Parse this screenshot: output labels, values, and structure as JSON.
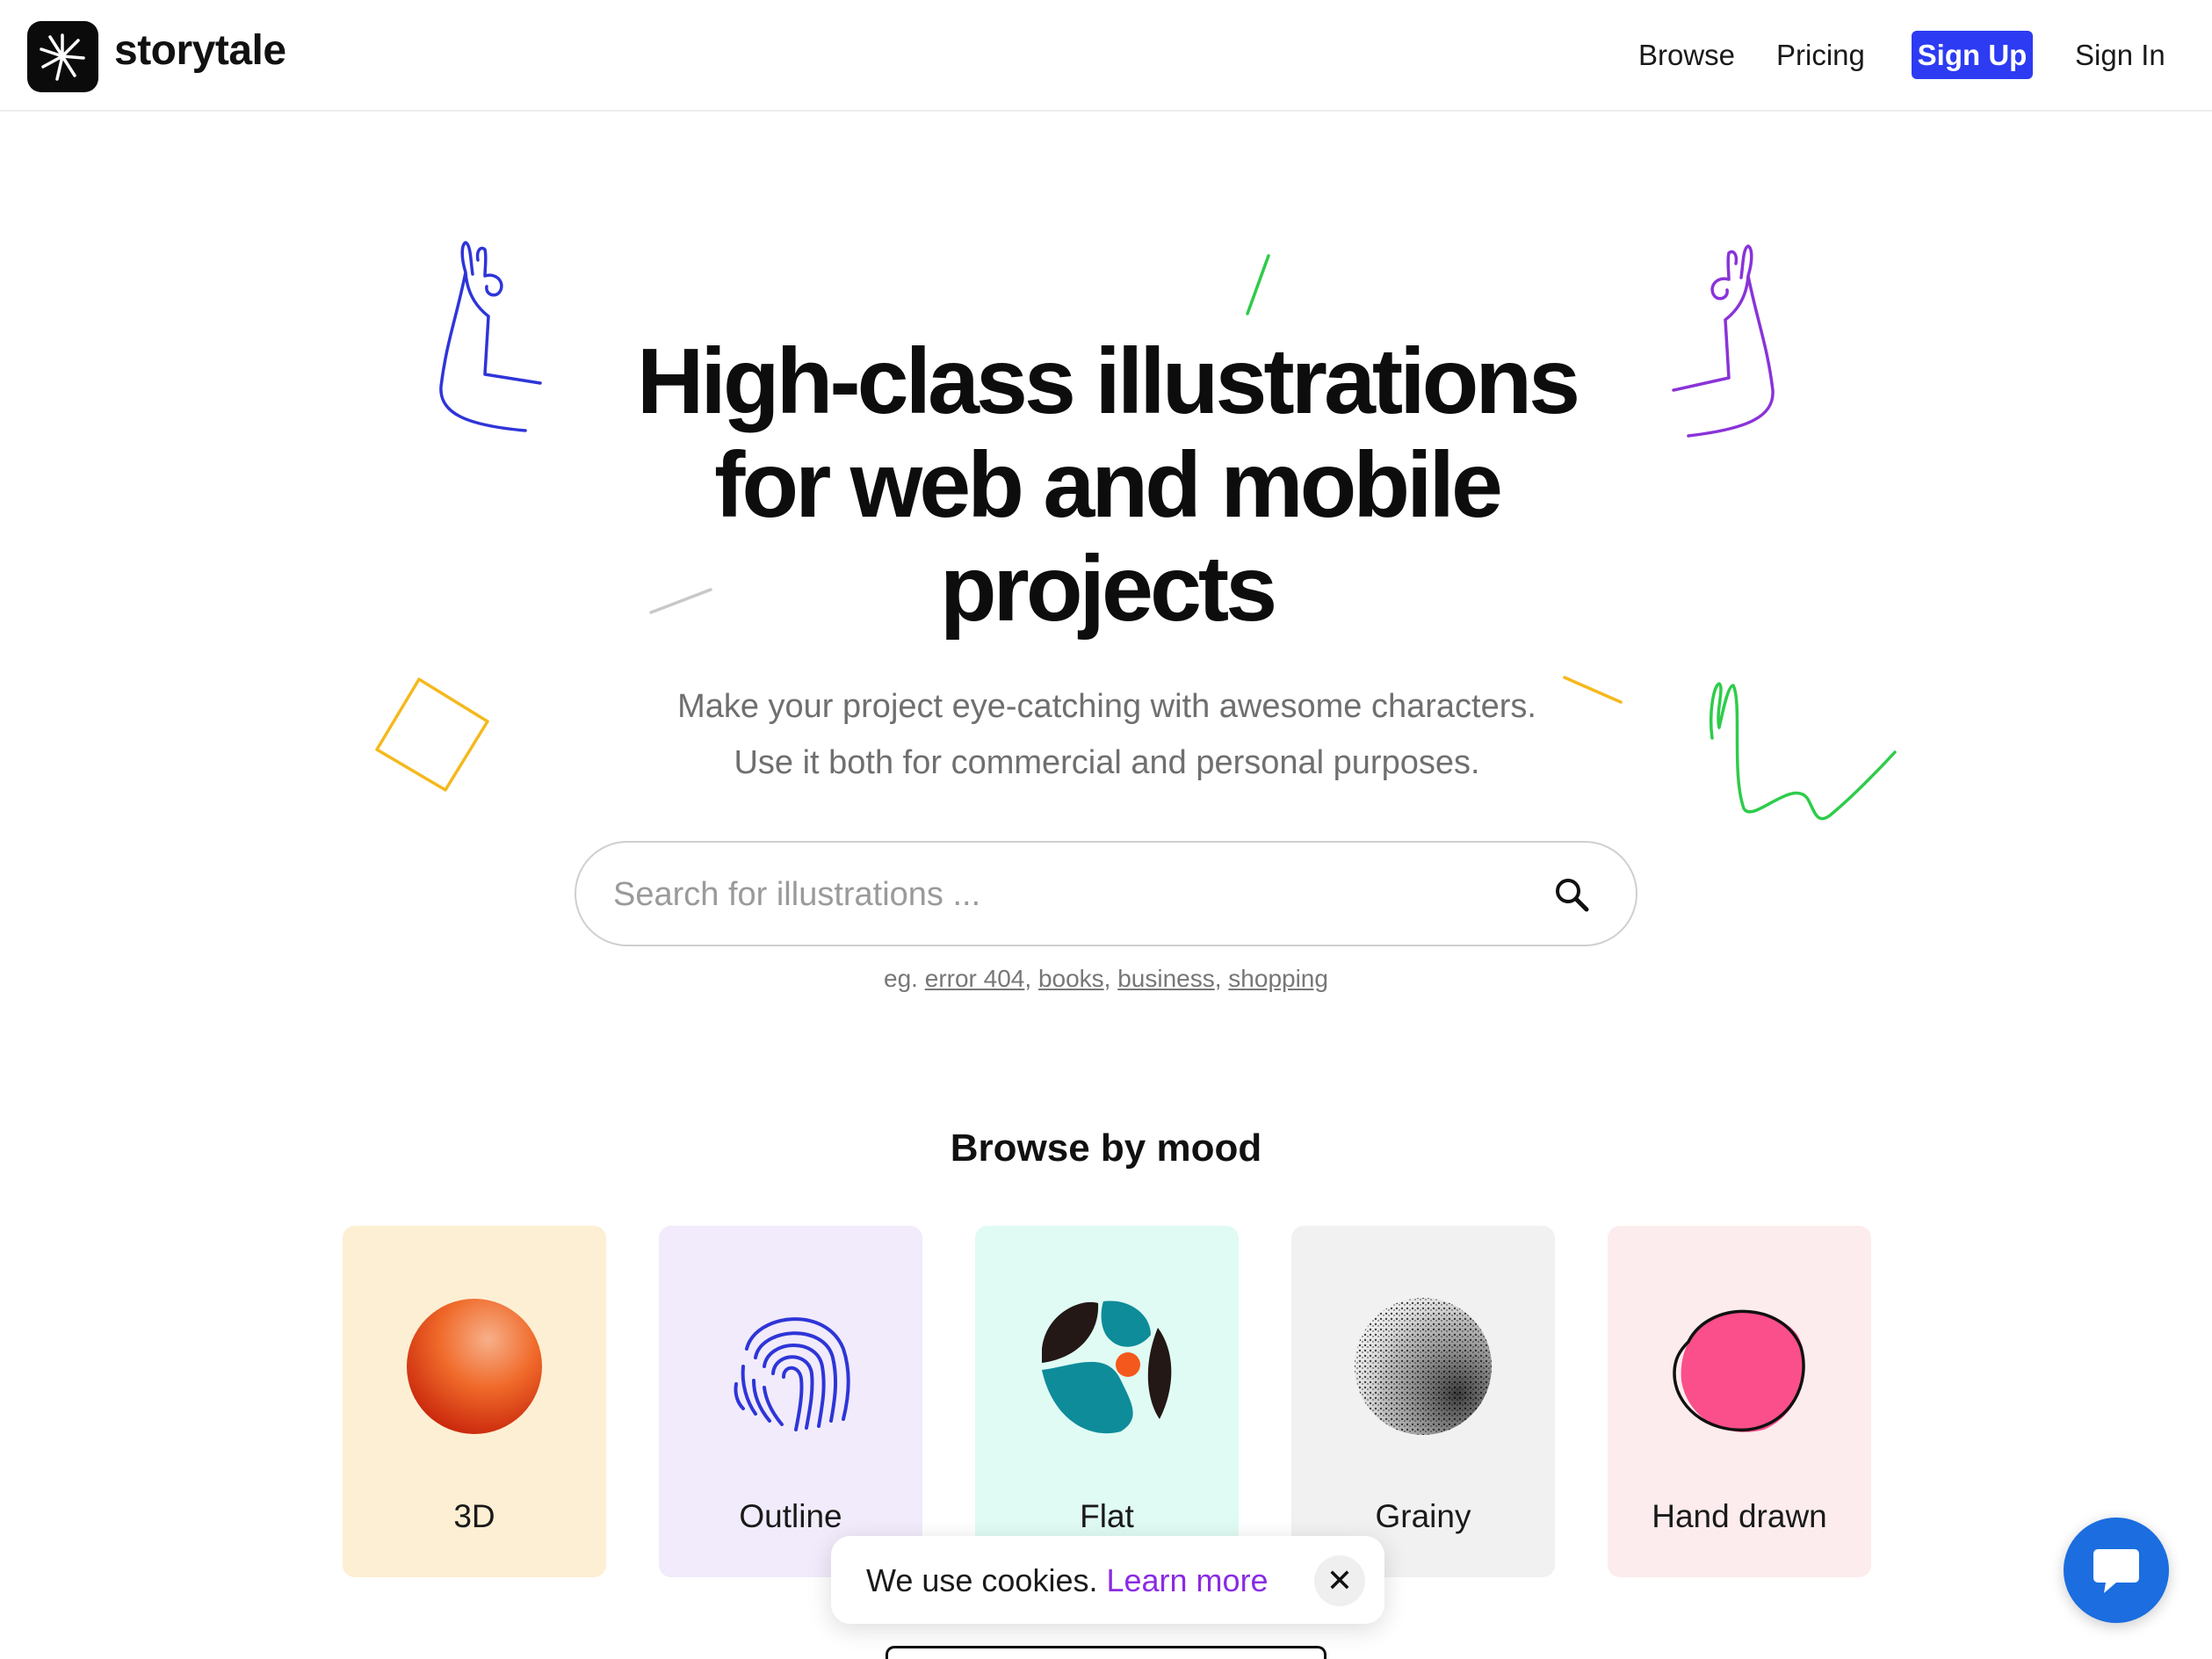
{
  "header": {
    "brand": "storytale",
    "nav": {
      "browse": "Browse",
      "pricing": "Pricing",
      "sign_up": "Sign Up",
      "sign_in": "Sign In"
    },
    "accent_color": "#2d3bf2"
  },
  "hero": {
    "title_line1": "High-class illustrations",
    "title_line2": "for web and mobile",
    "title_line3": "projects",
    "subtitle_line1": "Make your project eye-catching with awesome characters.",
    "subtitle_line2": "Use it both for commercial and personal purposes."
  },
  "search": {
    "placeholder": "Search for illustrations ...",
    "value": "",
    "examples_prefix": "eg.",
    "examples": [
      "error 404",
      "books",
      "business",
      "shopping"
    ]
  },
  "mood": {
    "title": "Browse by mood",
    "cards": [
      {
        "label": "3D",
        "bg": "#fdefd3"
      },
      {
        "label": "Outline",
        "bg": "#f1ebfb"
      },
      {
        "label": "Flat",
        "bg": "#e0fbf4"
      },
      {
        "label": "Grainy",
        "bg": "#f1f1f1"
      },
      {
        "label": "Hand drawn",
        "bg": "#fdeced"
      }
    ]
  },
  "cookie": {
    "text": "We use cookies.",
    "link": "Learn more",
    "close": "✕"
  },
  "icons": {
    "logo": "starburst-logo-icon",
    "search": "search-icon",
    "chat": "chat-icon",
    "close": "close-icon"
  }
}
